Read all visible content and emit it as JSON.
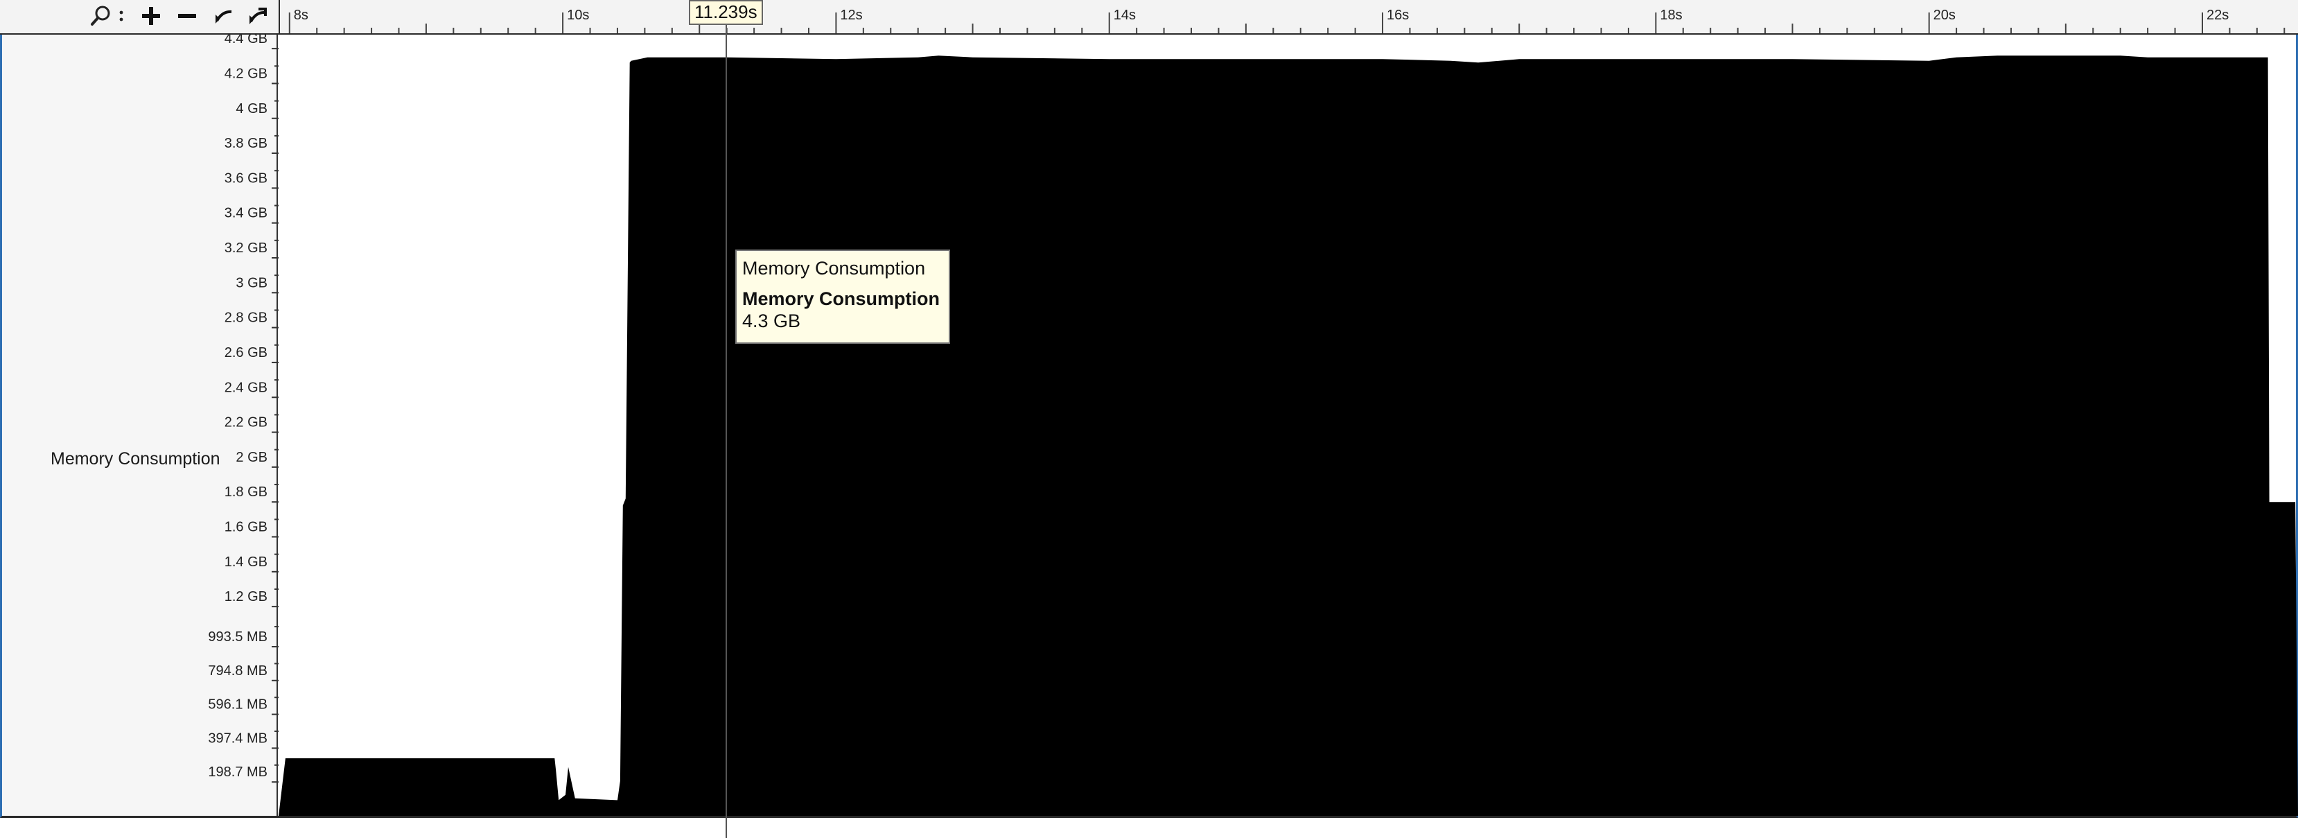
{
  "toolbar": {
    "buttons": [
      {
        "icon": "zoom-search-icon",
        "name": "zoom-tool-button"
      },
      {
        "icon": "zoom-in-icon",
        "name": "zoom-in-button"
      },
      {
        "icon": "zoom-out-icon",
        "name": "zoom-out-button"
      },
      {
        "icon": "zoom-undo-icon",
        "name": "zoom-undo-button"
      },
      {
        "icon": "zoom-reset-icon",
        "name": "zoom-reset-button"
      }
    ]
  },
  "track": {
    "label": "Memory Consumption"
  },
  "cursor": {
    "time_label": "11.239s"
  },
  "tooltip": {
    "title": "Memory Consumption",
    "series_name": "Memory Consumption",
    "value": "4.3 GB"
  },
  "chart_data": {
    "type": "area",
    "title": "",
    "xlabel": "",
    "ylabel": "",
    "x_ticks": [
      "8s",
      "10s",
      "12s",
      "14s",
      "16s",
      "18s",
      "20s",
      "22s"
    ],
    "y_ticks": [
      "198.7 MB",
      "397.4 MB",
      "596.1 MB",
      "794.8 MB",
      "993.5 MB",
      "1.2 GB",
      "1.4 GB",
      "1.6 GB",
      "1.8 GB",
      "2 GB",
      "2.2 GB",
      "2.4 GB",
      "2.6 GB",
      "2.8 GB",
      "3 GB",
      "3.2 GB",
      "3.4 GB",
      "3.6 GB",
      "3.8 GB",
      "4 GB",
      "4.2 GB",
      "4.4 GB"
    ],
    "y_tick_values_gb": [
      0.194,
      0.388,
      0.582,
      0.776,
      0.97,
      1.2,
      1.4,
      1.6,
      1.8,
      2.0,
      2.2,
      2.4,
      2.6,
      2.8,
      3.0,
      3.2,
      3.4,
      3.6,
      3.8,
      4.0,
      4.2,
      4.4
    ],
    "xlim": [
      7.92,
      22.7
    ],
    "ylim": [
      0,
      4.48
    ],
    "fill_color": "#000000",
    "series": [
      {
        "x": [
          7.92,
          7.97,
          9.94,
          9.95,
          9.97,
          10.02,
          10.04,
          10.09,
          10.4,
          10.42,
          10.44,
          10.46,
          10.49,
          10.5,
          10.62,
          11.2,
          12.0,
          12.6,
          12.75,
          13.0,
          14.0,
          15.0,
          16.0,
          16.5,
          16.7,
          17.0,
          18.0,
          19.0,
          20.0,
          20.2,
          20.5,
          21.0,
          21.4,
          21.6,
          22.0,
          22.48,
          22.49,
          22.68,
          22.7
        ],
        "y": [
          0.0,
          0.33,
          0.33,
          0.26,
          0.09,
          0.12,
          0.28,
          0.1,
          0.09,
          0.2,
          1.78,
          1.82,
          4.32,
          4.33,
          4.35,
          4.35,
          4.34,
          4.35,
          4.36,
          4.35,
          4.34,
          4.34,
          4.34,
          4.33,
          4.32,
          4.34,
          4.34,
          4.34,
          4.33,
          4.35,
          4.36,
          4.36,
          4.36,
          4.35,
          4.35,
          4.35,
          1.8,
          1.8,
          0.0
        ]
      }
    ],
    "grid": false,
    "legend": "none"
  }
}
